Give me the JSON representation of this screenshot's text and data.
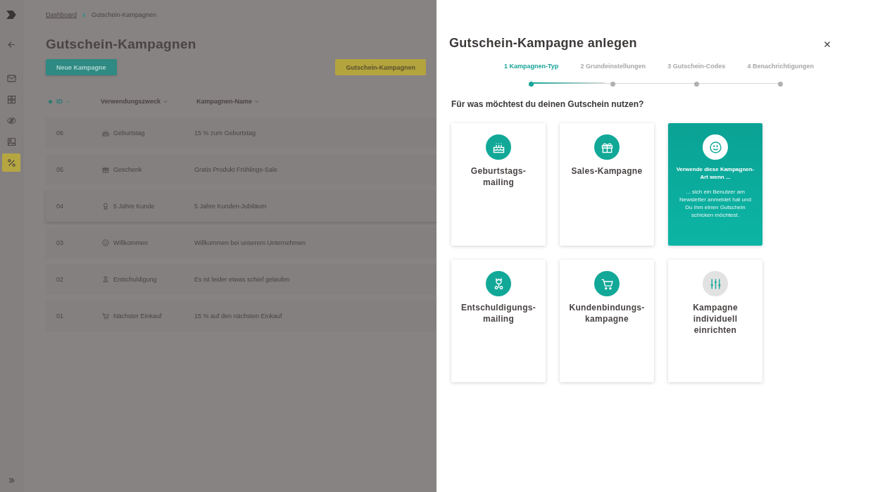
{
  "sidebar": {
    "nav": [
      {
        "kind": "back",
        "selected": false
      },
      {
        "kind": "mail",
        "selected": false
      },
      {
        "kind": "grid",
        "selected": false
      },
      {
        "kind": "eye",
        "selected": false
      },
      {
        "kind": "image",
        "selected": false
      },
      {
        "kind": "percent",
        "selected": true
      }
    ]
  },
  "breadcrumb": [
    {
      "label": "Dashboard",
      "link": true
    },
    {
      "label": "Gutschein-Kampagnen",
      "link": false
    }
  ],
  "page_title": "Gutschein-Kampagnen",
  "buttons": {
    "primary": "Neue Kampagne",
    "secondary": "Gutschein-Kampagnen"
  },
  "table": {
    "columns": [
      {
        "label": "ID",
        "sorted": true
      },
      {
        "label": "Verwendungszweck",
        "sorted": false
      },
      {
        "label": "Kampagnen-Name",
        "sorted": false
      }
    ],
    "rows": [
      {
        "id": "06",
        "kind": "birthday",
        "purpose": "Geburtstag",
        "name": "15 % zum Geburtstag",
        "highlighted": false
      },
      {
        "id": "05",
        "kind": "gift",
        "purpose": "Geschenk",
        "name": "Gratis Produkt Frühlings-Sale",
        "highlighted": false
      },
      {
        "id": "04",
        "kind": "award",
        "purpose": "5 Jahre Kunde",
        "name": "5 Jahre Kunden-Jubiläum",
        "highlighted": true
      },
      {
        "id": "03",
        "kind": "smile",
        "purpose": "Willkommen",
        "name": "Willkommen bei unserem Unternehmen",
        "highlighted": false
      },
      {
        "id": "02",
        "kind": "flower",
        "purpose": "Entschuldigung",
        "name": "Es ist leider etwas schief gelaufen",
        "highlighted": false
      },
      {
        "id": "01",
        "kind": "cart",
        "purpose": "Nächster Einkauf",
        "name": "15 % auf den nächsten Einkauf",
        "highlighted": false
      }
    ]
  },
  "drawer": {
    "title": "Gutschein-Kampagne anlegen",
    "steps": [
      {
        "label": "1 Kampagnen-Typ",
        "selected": true
      },
      {
        "label": "2 Grundeinstellungen",
        "selected": false
      },
      {
        "label": "3 Gutschein-Codes",
        "selected": false
      },
      {
        "label": "4 Benachrichtigungen",
        "selected": false
      }
    ],
    "question": "Für was möchtest du deinen Gutschein nutzen?",
    "cards": [
      {
        "kind": "birthday",
        "title": "Geburtstags-\nmailing",
        "selected": false
      },
      {
        "kind": "gift",
        "title": "Sales-Kampagne",
        "selected": false
      },
      {
        "kind": "smile",
        "selected": true,
        "hint_title": "Verwende diese Kampagnen-Art wenn ...",
        "hint_text": "... sich ein Benutzer am Newsletter anmeldet hat und Du ihm einen Gutschein schicken möchtest."
      },
      {
        "kind": "flower",
        "title": "Entschuldigungs-\nmailing",
        "selected": false
      },
      {
        "kind": "cart",
        "title": "Kundenbindungs-\nkampagne",
        "selected": false
      },
      {
        "kind": "sliders",
        "title": "Kampagne individuell einrichten",
        "selected": false
      }
    ]
  }
}
